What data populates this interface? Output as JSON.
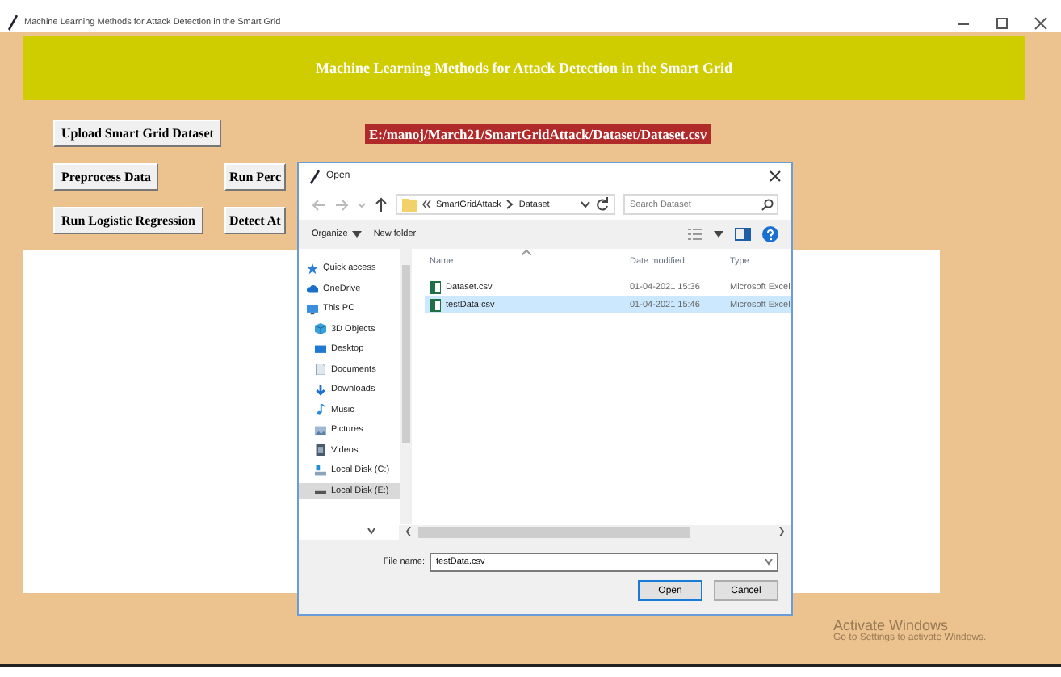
{
  "window": {
    "title": "Machine Learning Methods for Attack Detection in the Smart Grid"
  },
  "header": {
    "title": "Machine Learning Methods for Attack Detection in the Smart Grid"
  },
  "buttons": [
    {
      "label": "Upload Smart Grid Dataset"
    },
    {
      "label": "Preprocess Data"
    },
    {
      "label": "Run Perc"
    },
    {
      "label": "Run Logistic Regression"
    },
    {
      "label": "Detect At"
    }
  ],
  "path_label": "E:/manoj/March21/SmartGridAttack/Dataset/Dataset.csv",
  "dialog": {
    "title": "Open",
    "breadcrumb": [
      "SmartGridAttack",
      "Dataset"
    ],
    "search": {
      "placeholder": "Search Dataset"
    },
    "toolbar": [
      "Organize",
      "New folder"
    ],
    "nav": [
      {
        "label": "Quick access",
        "kind": "star",
        "selected": false
      },
      {
        "label": "OneDrive",
        "kind": "cloud",
        "selected": false
      },
      {
        "label": "This PC",
        "kind": "pc",
        "selected": false,
        "children": [
          {
            "label": "3D Objects",
            "kind": "cube",
            "selected": false
          },
          {
            "label": "Desktop",
            "kind": "desktop",
            "selected": false
          },
          {
            "label": "Documents",
            "kind": "document",
            "selected": false
          },
          {
            "label": "Downloads",
            "kind": "download",
            "selected": false
          },
          {
            "label": "Music",
            "kind": "music",
            "selected": false
          },
          {
            "label": "Pictures",
            "kind": "picture",
            "selected": false
          },
          {
            "label": "Videos",
            "kind": "video",
            "selected": false
          },
          {
            "label": "Local Disk (C:)",
            "kind": "system",
            "selected": false
          },
          {
            "label": "Local Disk (E:)",
            "kind": "drive",
            "selected": true
          }
        ]
      }
    ],
    "columns": [
      "Name",
      "Date modified",
      "Type"
    ],
    "files": [
      {
        "name": "Dataset.csv",
        "date": "01-04-2021 15:36",
        "type": "Microsoft Excel",
        "selected": false
      },
      {
        "name": "testData.csv",
        "date": "01-04-2021 15:46",
        "type": "Microsoft Excel",
        "selected": true
      }
    ],
    "file_name": {
      "label": "File name:",
      "value": "testData.csv"
    },
    "actions": [
      {
        "label": "Open",
        "default": true
      },
      {
        "label": "Cancel",
        "default": false
      }
    ]
  },
  "os_notice": [
    "Activate Windows",
    "Go to Settings to activate Windows."
  ]
}
